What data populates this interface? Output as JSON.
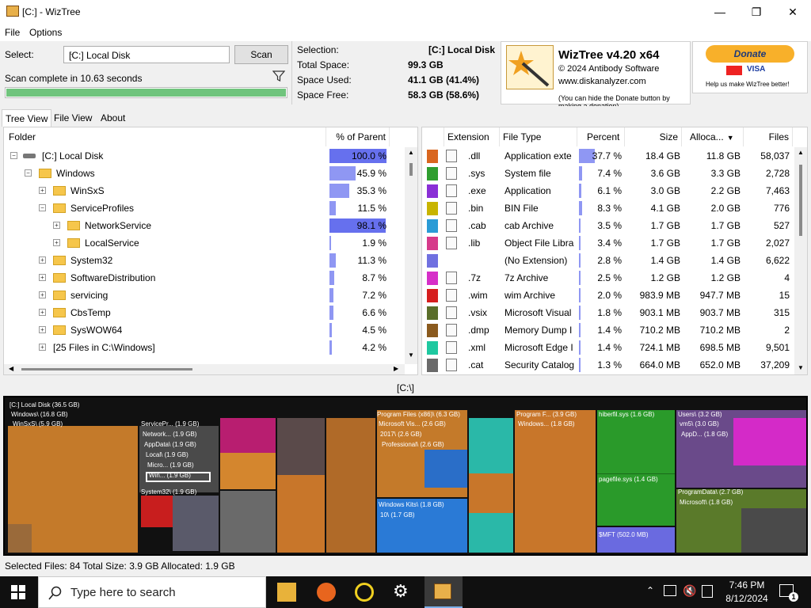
{
  "window": {
    "title": "[C:]  - WizTree"
  },
  "menu": [
    "File",
    "Options"
  ],
  "select": {
    "label": "Select:",
    "value": "[C:] Local Disk",
    "scan_label": "Scan",
    "status": "Scan complete in 10.63 seconds",
    "progress": 1.0
  },
  "info": {
    "selection_label": "Selection:",
    "selection_value": "[C:]  Local Disk",
    "total_label": "Total Space:",
    "total_value": "99.3 GB",
    "used_label": "Space Used:",
    "used_value": "41.1 GB  (41.4%)",
    "free_label": "Space Free:",
    "free_value": "58.3 GB  (58.6%)"
  },
  "brand": {
    "name": "WizTree v4.20 x64",
    "copyright": "© 2024 Antibody Software",
    "url": "www.diskanalyzer.com",
    "note": "(You can hide the Donate button by making a donation)"
  },
  "donate": {
    "label": "Donate",
    "help": "Help us make WizTree better!",
    "visa": "VISA"
  },
  "tabs": [
    "Tree View",
    "File View",
    "About"
  ],
  "tree": {
    "headers": {
      "folder": "Folder",
      "pct": "% of Parent"
    },
    "rows": [
      {
        "name": "[C:] Local Disk",
        "pct": "100.0 %",
        "p": 1.0,
        "level": 0,
        "exp": "−",
        "kind": "disk"
      },
      {
        "name": "Windows",
        "pct": "45.9 %",
        "p": 0.459,
        "level": 1,
        "exp": "−",
        "kind": "folder"
      },
      {
        "name": "WinSxS",
        "pct": "35.3 %",
        "p": 0.353,
        "level": 2,
        "exp": "+",
        "kind": "folder"
      },
      {
        "name": "ServiceProfiles",
        "pct": "11.5 %",
        "p": 0.115,
        "level": 2,
        "exp": "−",
        "kind": "folder"
      },
      {
        "name": "NetworkService",
        "pct": "98.1 %",
        "p": 0.981,
        "level": 3,
        "exp": "+",
        "kind": "folder"
      },
      {
        "name": "LocalService",
        "pct": "1.9 %",
        "p": 0.019,
        "level": 3,
        "exp": "+",
        "kind": "folder"
      },
      {
        "name": "System32",
        "pct": "11.3 %",
        "p": 0.113,
        "level": 2,
        "exp": "+",
        "kind": "folder"
      },
      {
        "name": "SoftwareDistribution",
        "pct": "8.7 %",
        "p": 0.087,
        "level": 2,
        "exp": "+",
        "kind": "folder"
      },
      {
        "name": "servicing",
        "pct": "7.2 %",
        "p": 0.072,
        "level": 2,
        "exp": "+",
        "kind": "folder"
      },
      {
        "name": "CbsTemp",
        "pct": "6.6 %",
        "p": 0.066,
        "level": 2,
        "exp": "+",
        "kind": "folder"
      },
      {
        "name": "SysWOW64",
        "pct": "4.5 %",
        "p": 0.045,
        "level": 2,
        "exp": "+",
        "kind": "folder"
      },
      {
        "name": "[25 Files in C:\\Windows]",
        "pct": "4.2 %",
        "p": 0.042,
        "level": 2,
        "exp": "+",
        "kind": "files"
      }
    ]
  },
  "ext": {
    "headers": {
      "ext": "Extension",
      "type": "File Type",
      "pct": "Percent",
      "size": "Size",
      "alloc": "Alloca...",
      "files": "Files"
    },
    "rows": [
      {
        "color": "#d9661f",
        "ext": ".dll",
        "type": "Application exte",
        "pct": "37.7 %",
        "p": 0.377,
        "size": "18.4 GB",
        "alloc": "11.8 GB",
        "files": "58,037"
      },
      {
        "color": "#2f9e2f",
        "ext": ".sys",
        "type": "System file",
        "pct": "7.4 %",
        "p": 0.074,
        "size": "3.6 GB",
        "alloc": "3.3 GB",
        "files": "2,728"
      },
      {
        "color": "#8a2fd6",
        "ext": ".exe",
        "type": "Application",
        "pct": "6.1 %",
        "p": 0.061,
        "size": "3.0 GB",
        "alloc": "2.2 GB",
        "files": "7,463"
      },
      {
        "color": "#c8b400",
        "ext": ".bin",
        "type": "BIN File",
        "pct": "8.3 %",
        "p": 0.083,
        "size": "4.1 GB",
        "alloc": "2.0 GB",
        "files": "776"
      },
      {
        "color": "#2a9bd6",
        "ext": ".cab",
        "type": "cab Archive",
        "pct": "3.5 %",
        "p": 0.035,
        "size": "1.7 GB",
        "alloc": "1.7 GB",
        "files": "527"
      },
      {
        "color": "#d63a8a",
        "ext": ".lib",
        "type": "Object File Libra",
        "pct": "3.4 %",
        "p": 0.034,
        "size": "1.7 GB",
        "alloc": "1.7 GB",
        "files": "2,027"
      },
      {
        "color": "#7070e0",
        "ext": "",
        "type": "(No Extension)",
        "pct": "2.8 %",
        "p": 0.028,
        "size": "1.4 GB",
        "alloc": "1.4 GB",
        "files": "6,622"
      },
      {
        "color": "#d62fc8",
        "ext": ".7z",
        "type": "7z Archive",
        "pct": "2.5 %",
        "p": 0.025,
        "size": "1.2 GB",
        "alloc": "1.2 GB",
        "files": "4"
      },
      {
        "color": "#d61e1e",
        "ext": ".wim",
        "type": "wim Archive",
        "pct": "2.0 %",
        "p": 0.02,
        "size": "983.9 MB",
        "alloc": "947.7 MB",
        "files": "15"
      },
      {
        "color": "#5a6e2a",
        "ext": ".vsix",
        "type": "Microsoft Visual",
        "pct": "1.8 %",
        "p": 0.018,
        "size": "903.1 MB",
        "alloc": "903.7 MB",
        "files": "315"
      },
      {
        "color": "#8a5a1e",
        "ext": ".dmp",
        "type": "Memory Dump I",
        "pct": "1.4 %",
        "p": 0.014,
        "size": "710.2 MB",
        "alloc": "710.2 MB",
        "files": "2"
      },
      {
        "color": "#1ec8a0",
        "ext": ".xml",
        "type": "Microsoft Edge I",
        "pct": "1.4 %",
        "p": 0.014,
        "size": "724.1 MB",
        "alloc": "698.5 MB",
        "files": "9,501"
      },
      {
        "color": "#6a6a6a",
        "ext": ".cat",
        "type": "Security Catalog",
        "pct": "1.3 %",
        "p": 0.013,
        "size": "664.0 MB",
        "alloc": "652.0 MB",
        "files": "37,209"
      }
    ]
  },
  "path": "[C:\\]",
  "treemap_labels": [
    "[C:] Local Disk (36.5 GB)",
    "Windows\\ (16.8 GB)",
    "WinSxS\\ (5.9 GB)",
    "ServicePr... (1.9 GB)",
    "Network... (1.9 GB)",
    "AppData\\ (1.9 GB)",
    "Local\\ (1.9 GB)",
    "Micro... (1.9 GB)",
    "Win... (1.9 GB)",
    "System32\\ (1.9 GB)",
    "Program Files (x86)\\ (6.3 GB)",
    "Microsoft Vis... (2.6 GB)",
    "2017\\ (2.6 GB)",
    "Professional\\ (2.6 GB)",
    "Windows Kits\\ (1.8 GB)",
    "10\\ (1.7 GB)",
    "Program F... (3.9 GB)",
    "Windows... (1.8 GB)",
    "hiberfil.sys (1.6 GB)",
    "pagefile.sys (1.4 GB)",
    "$MFT (502.0 MB)",
    "Users\\ (3.2 GB)",
    "vm5\\ (3.0 GB)",
    "AppD... (1.8 GB)",
    "ProgramData\\ (2.7 GB)",
    "Microsoft\\ (1.8 GB)"
  ],
  "status": "Selected Files: 84  Total Size: 3.9 GB  Allocated: 1.9 GB",
  "taskbar": {
    "search_placeholder": "Type here to search",
    "time": "7:46 PM",
    "date": "8/12/2024"
  }
}
